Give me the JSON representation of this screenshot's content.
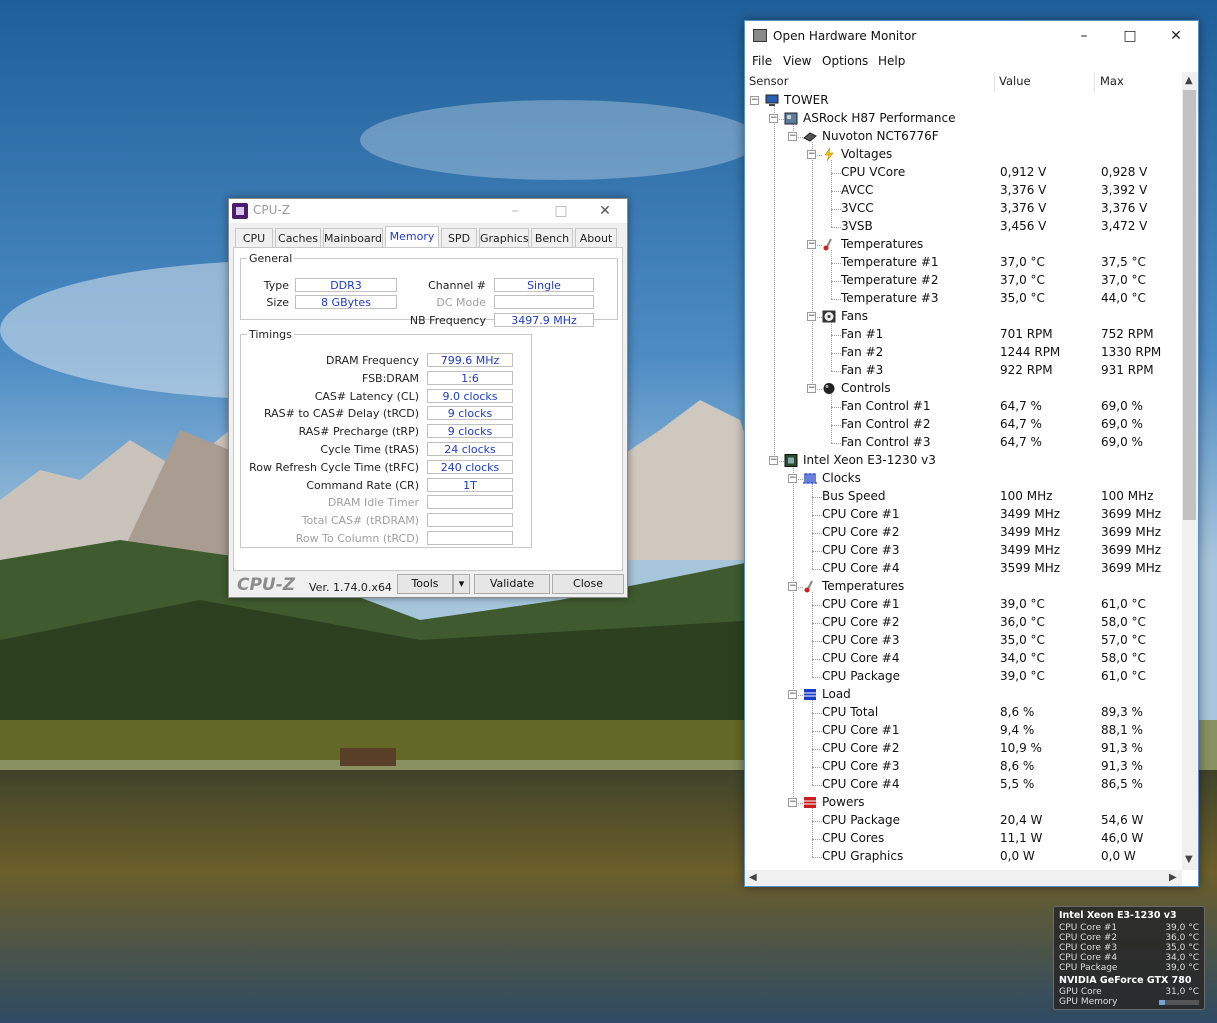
{
  "colors": {
    "cpuz_value_text": "#1c3cc4",
    "ohm_border": "#5a8fc8",
    "gadget_bg": "#282828"
  },
  "cpuz": {
    "title": "CPU-Z",
    "tabs": [
      "CPU",
      "Caches",
      "Mainboard",
      "Memory",
      "SPD",
      "Graphics",
      "Bench",
      "About"
    ],
    "active_tab": "Memory",
    "general": {
      "legend": "General",
      "type_label": "Type",
      "type_value": "DDR3",
      "size_label": "Size",
      "size_value": "8 GBytes",
      "channel_label": "Channel #",
      "channel_value": "Single",
      "dcmode_label": "DC Mode",
      "dcmode_value": "",
      "nbfreq_label": "NB Frequency",
      "nbfreq_value": "3497.9 MHz"
    },
    "timings": {
      "legend": "Timings",
      "rows": [
        {
          "label": "DRAM Frequency",
          "value": "799.6 MHz",
          "dim": false
        },
        {
          "label": "FSB:DRAM",
          "value": "1:6",
          "dim": false
        },
        {
          "label": "CAS# Latency (CL)",
          "value": "9.0 clocks",
          "dim": false
        },
        {
          "label": "RAS# to CAS# Delay (tRCD)",
          "value": "9 clocks",
          "dim": false
        },
        {
          "label": "RAS# Precharge (tRP)",
          "value": "9 clocks",
          "dim": false
        },
        {
          "label": "Cycle Time (tRAS)",
          "value": "24 clocks",
          "dim": false
        },
        {
          "label": "Row Refresh Cycle Time (tRFC)",
          "value": "240 clocks",
          "dim": false
        },
        {
          "label": "Command Rate (CR)",
          "value": "1T",
          "dim": false
        },
        {
          "label": "DRAM Idle Timer",
          "value": "",
          "dim": true
        },
        {
          "label": "Total CAS# (tRDRAM)",
          "value": "",
          "dim": true
        },
        {
          "label": "Row To Column (tRCD)",
          "value": "",
          "dim": true
        }
      ]
    },
    "logo": "CPU-Z",
    "version": "Ver. 1.74.0.x64",
    "tools_label": "Tools",
    "validate_label": "Validate",
    "close_label": "Close"
  },
  "ohm": {
    "title": "Open Hardware Monitor",
    "menu": [
      "File",
      "View",
      "Options",
      "Help"
    ],
    "columns": {
      "sensor": "Sensor",
      "value": "Value",
      "max": "Max"
    },
    "rows": [
      {
        "level": 0,
        "name": "TOWER",
        "value": "",
        "max": "",
        "icon": "computer-icon",
        "toggle": true
      },
      {
        "level": 1,
        "name": "ASRock H87 Performance",
        "value": "",
        "max": "",
        "icon": "motherboard-icon",
        "toggle": true
      },
      {
        "level": 2,
        "name": "Nuvoton NCT6776F",
        "value": "",
        "max": "",
        "icon": "chip-icon",
        "toggle": true
      },
      {
        "level": 3,
        "name": "Voltages",
        "value": "",
        "max": "",
        "icon": "lightning-icon",
        "toggle": true
      },
      {
        "level": 4,
        "name": "CPU VCore",
        "value": "0,912 V",
        "max": "0,928 V"
      },
      {
        "level": 4,
        "name": "AVCC",
        "value": "3,376 V",
        "max": "3,392 V"
      },
      {
        "level": 4,
        "name": "3VCC",
        "value": "3,376 V",
        "max": "3,376 V"
      },
      {
        "level": 4,
        "name": "3VSB",
        "value": "3,456 V",
        "max": "3,472 V"
      },
      {
        "level": 3,
        "name": "Temperatures",
        "value": "",
        "max": "",
        "icon": "thermometer-icon",
        "toggle": true
      },
      {
        "level": 4,
        "name": "Temperature #1",
        "value": "37,0 °C",
        "max": "37,5 °C"
      },
      {
        "level": 4,
        "name": "Temperature #2",
        "value": "37,0 °C",
        "max": "37,0 °C"
      },
      {
        "level": 4,
        "name": "Temperature #3",
        "value": "35,0 °C",
        "max": "44,0 °C"
      },
      {
        "level": 3,
        "name": "Fans",
        "value": "",
        "max": "",
        "icon": "fan-icon",
        "toggle": true
      },
      {
        "level": 4,
        "name": "Fan #1",
        "value": "701 RPM",
        "max": "752 RPM"
      },
      {
        "level": 4,
        "name": "Fan #2",
        "value": "1244 RPM",
        "max": "1330 RPM"
      },
      {
        "level": 4,
        "name": "Fan #3",
        "value": "922 RPM",
        "max": "931 RPM"
      },
      {
        "level": 3,
        "name": "Controls",
        "value": "",
        "max": "",
        "icon": "control-icon",
        "toggle": true
      },
      {
        "level": 4,
        "name": "Fan Control #1",
        "value": "64,7 %",
        "max": "69,0 %"
      },
      {
        "level": 4,
        "name": "Fan Control #2",
        "value": "64,7 %",
        "max": "69,0 %"
      },
      {
        "level": 4,
        "name": "Fan Control #3",
        "value": "64,7 %",
        "max": "69,0 %"
      },
      {
        "level": 1,
        "name": "Intel Xeon E3-1230 v3",
        "value": "",
        "max": "",
        "icon": "cpu-icon",
        "toggle": true
      },
      {
        "level": 2,
        "name": "Clocks",
        "value": "",
        "max": "",
        "icon": "clock-signal-icon",
        "toggle": true
      },
      {
        "level": 3,
        "name": "Bus Speed",
        "value": "100 MHz",
        "max": "100 MHz"
      },
      {
        "level": 3,
        "name": "CPU Core #1",
        "value": "3499 MHz",
        "max": "3699 MHz"
      },
      {
        "level": 3,
        "name": "CPU Core #2",
        "value": "3499 MHz",
        "max": "3699 MHz"
      },
      {
        "level": 3,
        "name": "CPU Core #3",
        "value": "3499 MHz",
        "max": "3699 MHz"
      },
      {
        "level": 3,
        "name": "CPU Core #4",
        "value": "3599 MHz",
        "max": "3699 MHz"
      },
      {
        "level": 2,
        "name": "Temperatures",
        "value": "",
        "max": "",
        "icon": "thermometer-icon",
        "toggle": true
      },
      {
        "level": 3,
        "name": "CPU Core #1",
        "value": "39,0 °C",
        "max": "61,0 °C"
      },
      {
        "level": 3,
        "name": "CPU Core #2",
        "value": "36,0 °C",
        "max": "58,0 °C"
      },
      {
        "level": 3,
        "name": "CPU Core #3",
        "value": "35,0 °C",
        "max": "57,0 °C"
      },
      {
        "level": 3,
        "name": "CPU Core #4",
        "value": "34,0 °C",
        "max": "58,0 °C"
      },
      {
        "level": 3,
        "name": "CPU Package",
        "value": "39,0 °C",
        "max": "61,0 °C"
      },
      {
        "level": 2,
        "name": "Load",
        "value": "",
        "max": "",
        "icon": "load-icon",
        "toggle": true
      },
      {
        "level": 3,
        "name": "CPU Total",
        "value": "8,6 %",
        "max": "89,3 %"
      },
      {
        "level": 3,
        "name": "CPU Core #1",
        "value": "9,4 %",
        "max": "88,1 %"
      },
      {
        "level": 3,
        "name": "CPU Core #2",
        "value": "10,9 %",
        "max": "91,3 %"
      },
      {
        "level": 3,
        "name": "CPU Core #3",
        "value": "8,6 %",
        "max": "91,3 %"
      },
      {
        "level": 3,
        "name": "CPU Core #4",
        "value": "5,5 %",
        "max": "86,5 %"
      },
      {
        "level": 2,
        "name": "Powers",
        "value": "",
        "max": "",
        "icon": "power-icon",
        "toggle": true
      },
      {
        "level": 3,
        "name": "CPU Package",
        "value": "20,4 W",
        "max": "54,6 W"
      },
      {
        "level": 3,
        "name": "CPU Cores",
        "value": "11,1 W",
        "max": "46,0 W"
      },
      {
        "level": 3,
        "name": "CPU Graphics",
        "value": "0,0 W",
        "max": "0,0 W"
      }
    ]
  },
  "gadget": {
    "cpu_title": "Intel Xeon E3-1230 v3",
    "cpu_rows": [
      {
        "name": "CPU Core #1",
        "value": "39,0 °C"
      },
      {
        "name": "CPU Core #2",
        "value": "36,0 °C"
      },
      {
        "name": "CPU Core #3",
        "value": "35,0 °C"
      },
      {
        "name": "CPU Core #4",
        "value": "34,0 °C"
      },
      {
        "name": "CPU Package",
        "value": "39,0 °C"
      }
    ],
    "gpu_title": "NVIDIA GeForce GTX 780",
    "gpu_core_label": "GPU Core",
    "gpu_core_value": "31,0 °C",
    "gpu_memory_label": "GPU Memory",
    "gpu_memory_load_fraction": 0.15
  }
}
